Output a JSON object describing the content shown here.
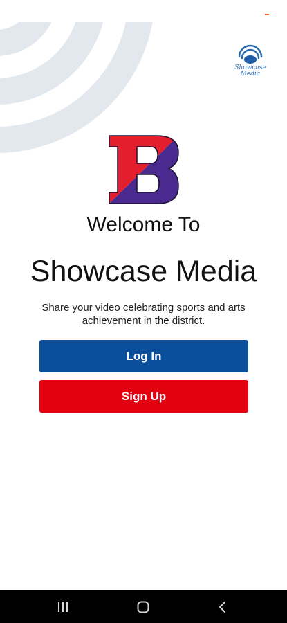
{
  "splash": {
    "welcome_text": "Welcome To",
    "app_name": "Showcase Media",
    "tagline": "Share your video celebrating sports and arts achievement in the district."
  },
  "corner_logo": {
    "text_line1": "Showcase",
    "text_line2": "Media"
  },
  "actions": {
    "login_label": "Log In",
    "signup_label": "Sign Up"
  },
  "colors": {
    "brand_blue": "#0b4e9c",
    "brand_red": "#e3000f",
    "logo_purple": "#4b2a8f",
    "logo_red": "#e31e2d",
    "arc_gray": "#e3e8ee",
    "status_accent": "#f15a22"
  },
  "nav": {
    "icons": [
      "recents-icon",
      "home-icon",
      "back-icon"
    ]
  }
}
